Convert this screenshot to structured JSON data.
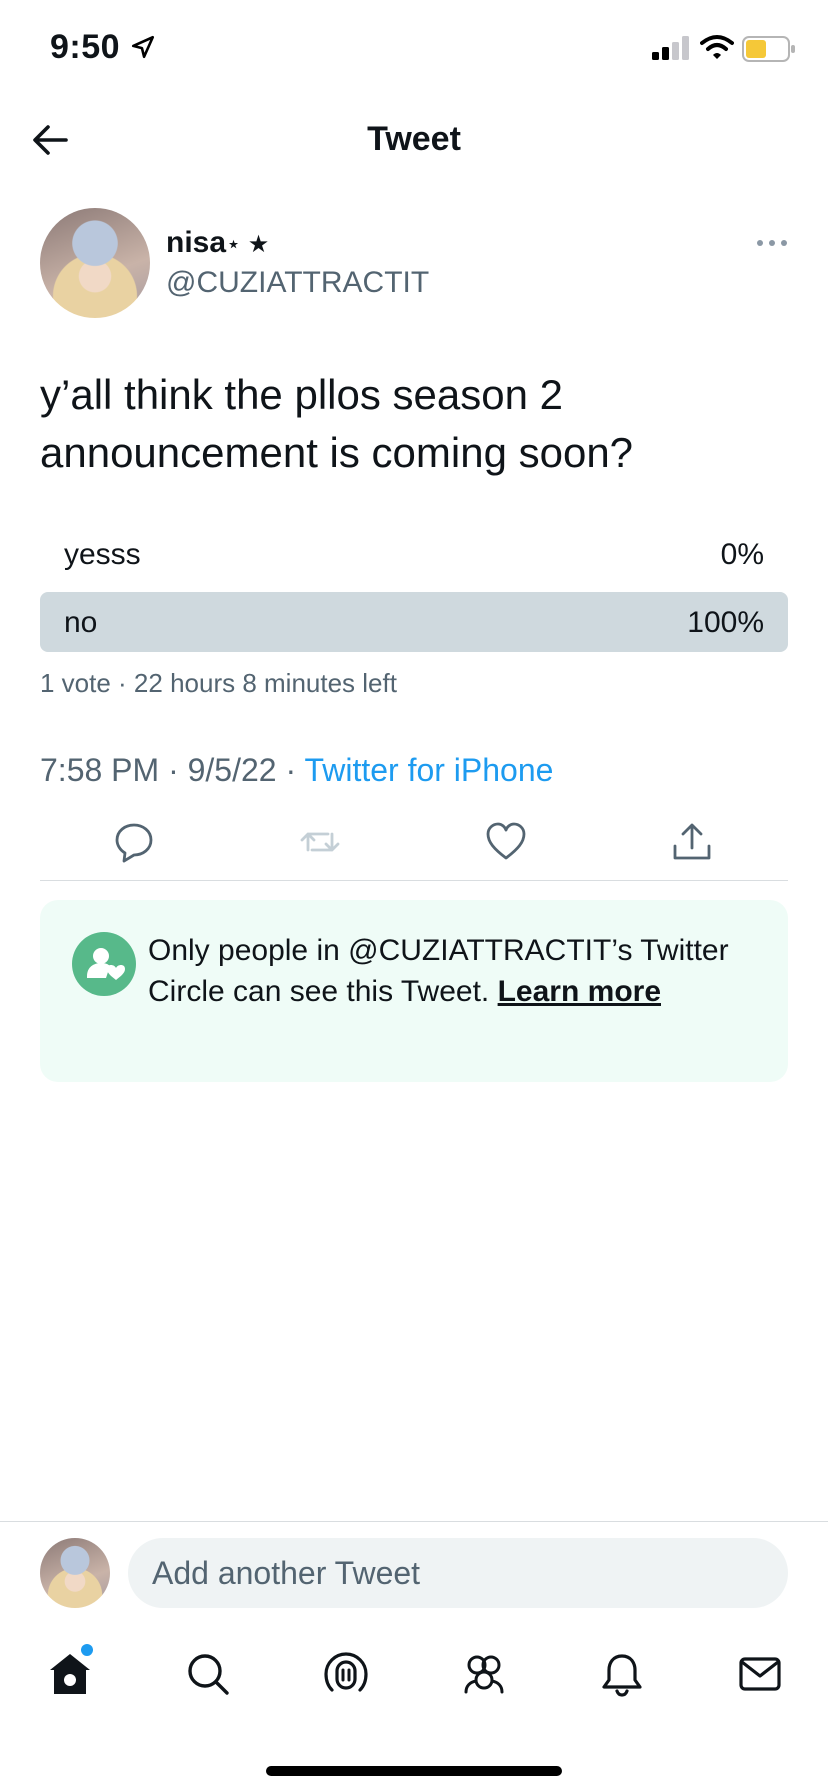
{
  "status_bar": {
    "time": "9:50",
    "battery_color": "#f5c838"
  },
  "header": {
    "title": "Tweet",
    "back_icon": "arrow-left-icon"
  },
  "tweet": {
    "author": {
      "name": "nisa",
      "name_suffix": "⋆ ★",
      "handle": "@CUZIATTRACTIT"
    },
    "text": "y’all think the pllos season 2 announcement is coming soon?",
    "poll": {
      "options": [
        {
          "label": "yesss",
          "percent": "0%",
          "share": 0
        },
        {
          "label": "no",
          "percent": "100%",
          "share": 1
        }
      ],
      "meta": "1 vote · 22 hours 8 minutes left"
    },
    "timestamp": "7:58 PM · 9/5/22 · ",
    "source": "Twitter for iPhone",
    "actions": [
      "reply-icon",
      "retweet-icon",
      "like-icon",
      "share-icon"
    ]
  },
  "circle_notice": {
    "text": "Only people in @CUZIATTRACTIT’s Twitter Circle can see this Tweet. ",
    "link": "Learn more",
    "accent": "#57b98a",
    "background": "#effcf7"
  },
  "reply": {
    "placeholder": "Add another Tweet"
  },
  "tab_bar": {
    "items": [
      "home-icon",
      "search-icon",
      "spaces-icon",
      "communities-icon",
      "notifications-icon",
      "messages-icon"
    ],
    "accent": "#1d9bf0"
  }
}
